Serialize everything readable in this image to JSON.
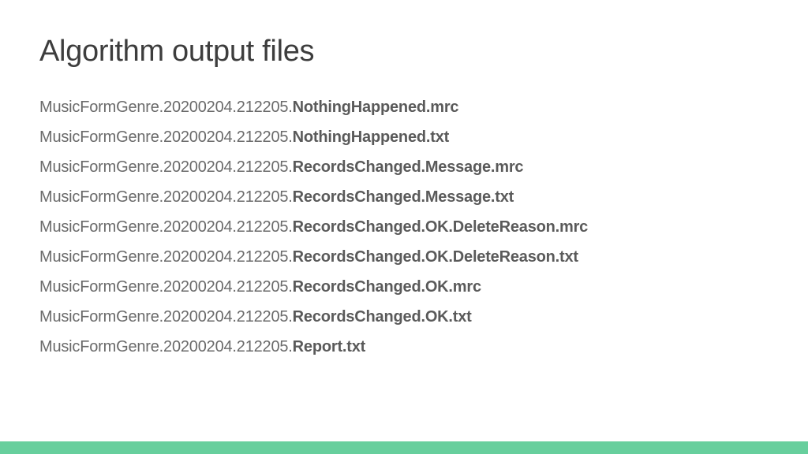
{
  "title": "Algorithm output files",
  "file_prefix": "MusicFormGenre.20200204.212205.",
  "files": [
    {
      "suffix": "NothingHappened.mrc"
    },
    {
      "suffix": "NothingHappened.txt"
    },
    {
      "suffix": "RecordsChanged.Message.mrc"
    },
    {
      "suffix": "RecordsChanged.Message.txt"
    },
    {
      "suffix": "RecordsChanged.OK.DeleteReason.mrc"
    },
    {
      "suffix": "RecordsChanged.OK.DeleteReason.txt"
    },
    {
      "suffix": "RecordsChanged.OK.mrc"
    },
    {
      "suffix": "RecordsChanged.OK.txt"
    },
    {
      "suffix": "Report.txt"
    }
  ],
  "accent_color": "#67cf9d"
}
